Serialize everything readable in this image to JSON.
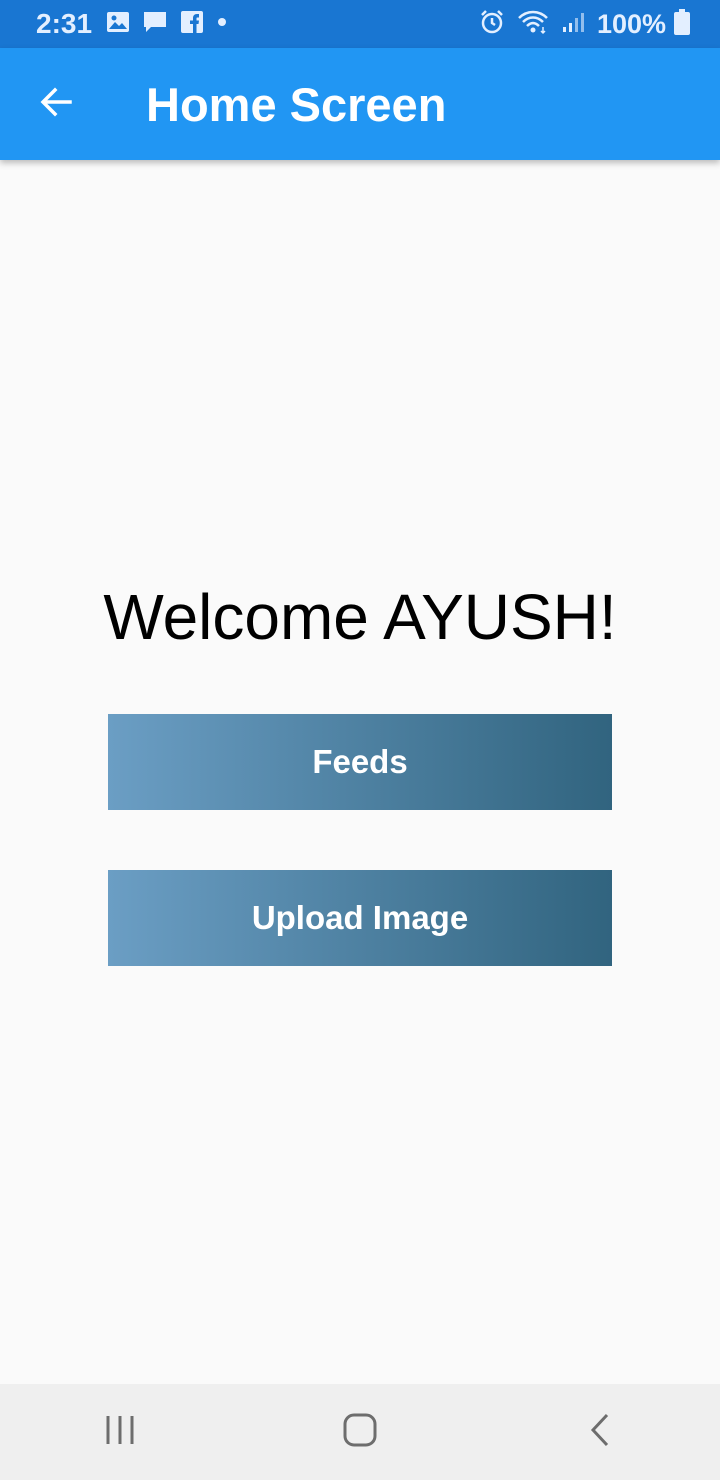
{
  "status_bar": {
    "time": "2:31",
    "battery": "100%",
    "notification_icons": [
      "gallery-icon",
      "message-icon",
      "facebook-icon",
      "dot-icon"
    ],
    "system_icons": [
      "alarm-icon",
      "wifi-icon",
      "signal-icon",
      "battery-icon"
    ]
  },
  "app_bar": {
    "title": "Home Screen",
    "back_icon": "arrow-left-icon",
    "background": "#2196f3"
  },
  "main": {
    "welcome_text": "Welcome AYUSH!",
    "buttons": [
      {
        "label": "Feeds"
      },
      {
        "label": "Upload Image"
      }
    ],
    "button_gradient": [
      "#6b9ec4",
      "#31647f"
    ]
  },
  "nav_bar": {
    "icons": [
      "recent-apps-icon",
      "home-icon",
      "back-icon"
    ]
  }
}
